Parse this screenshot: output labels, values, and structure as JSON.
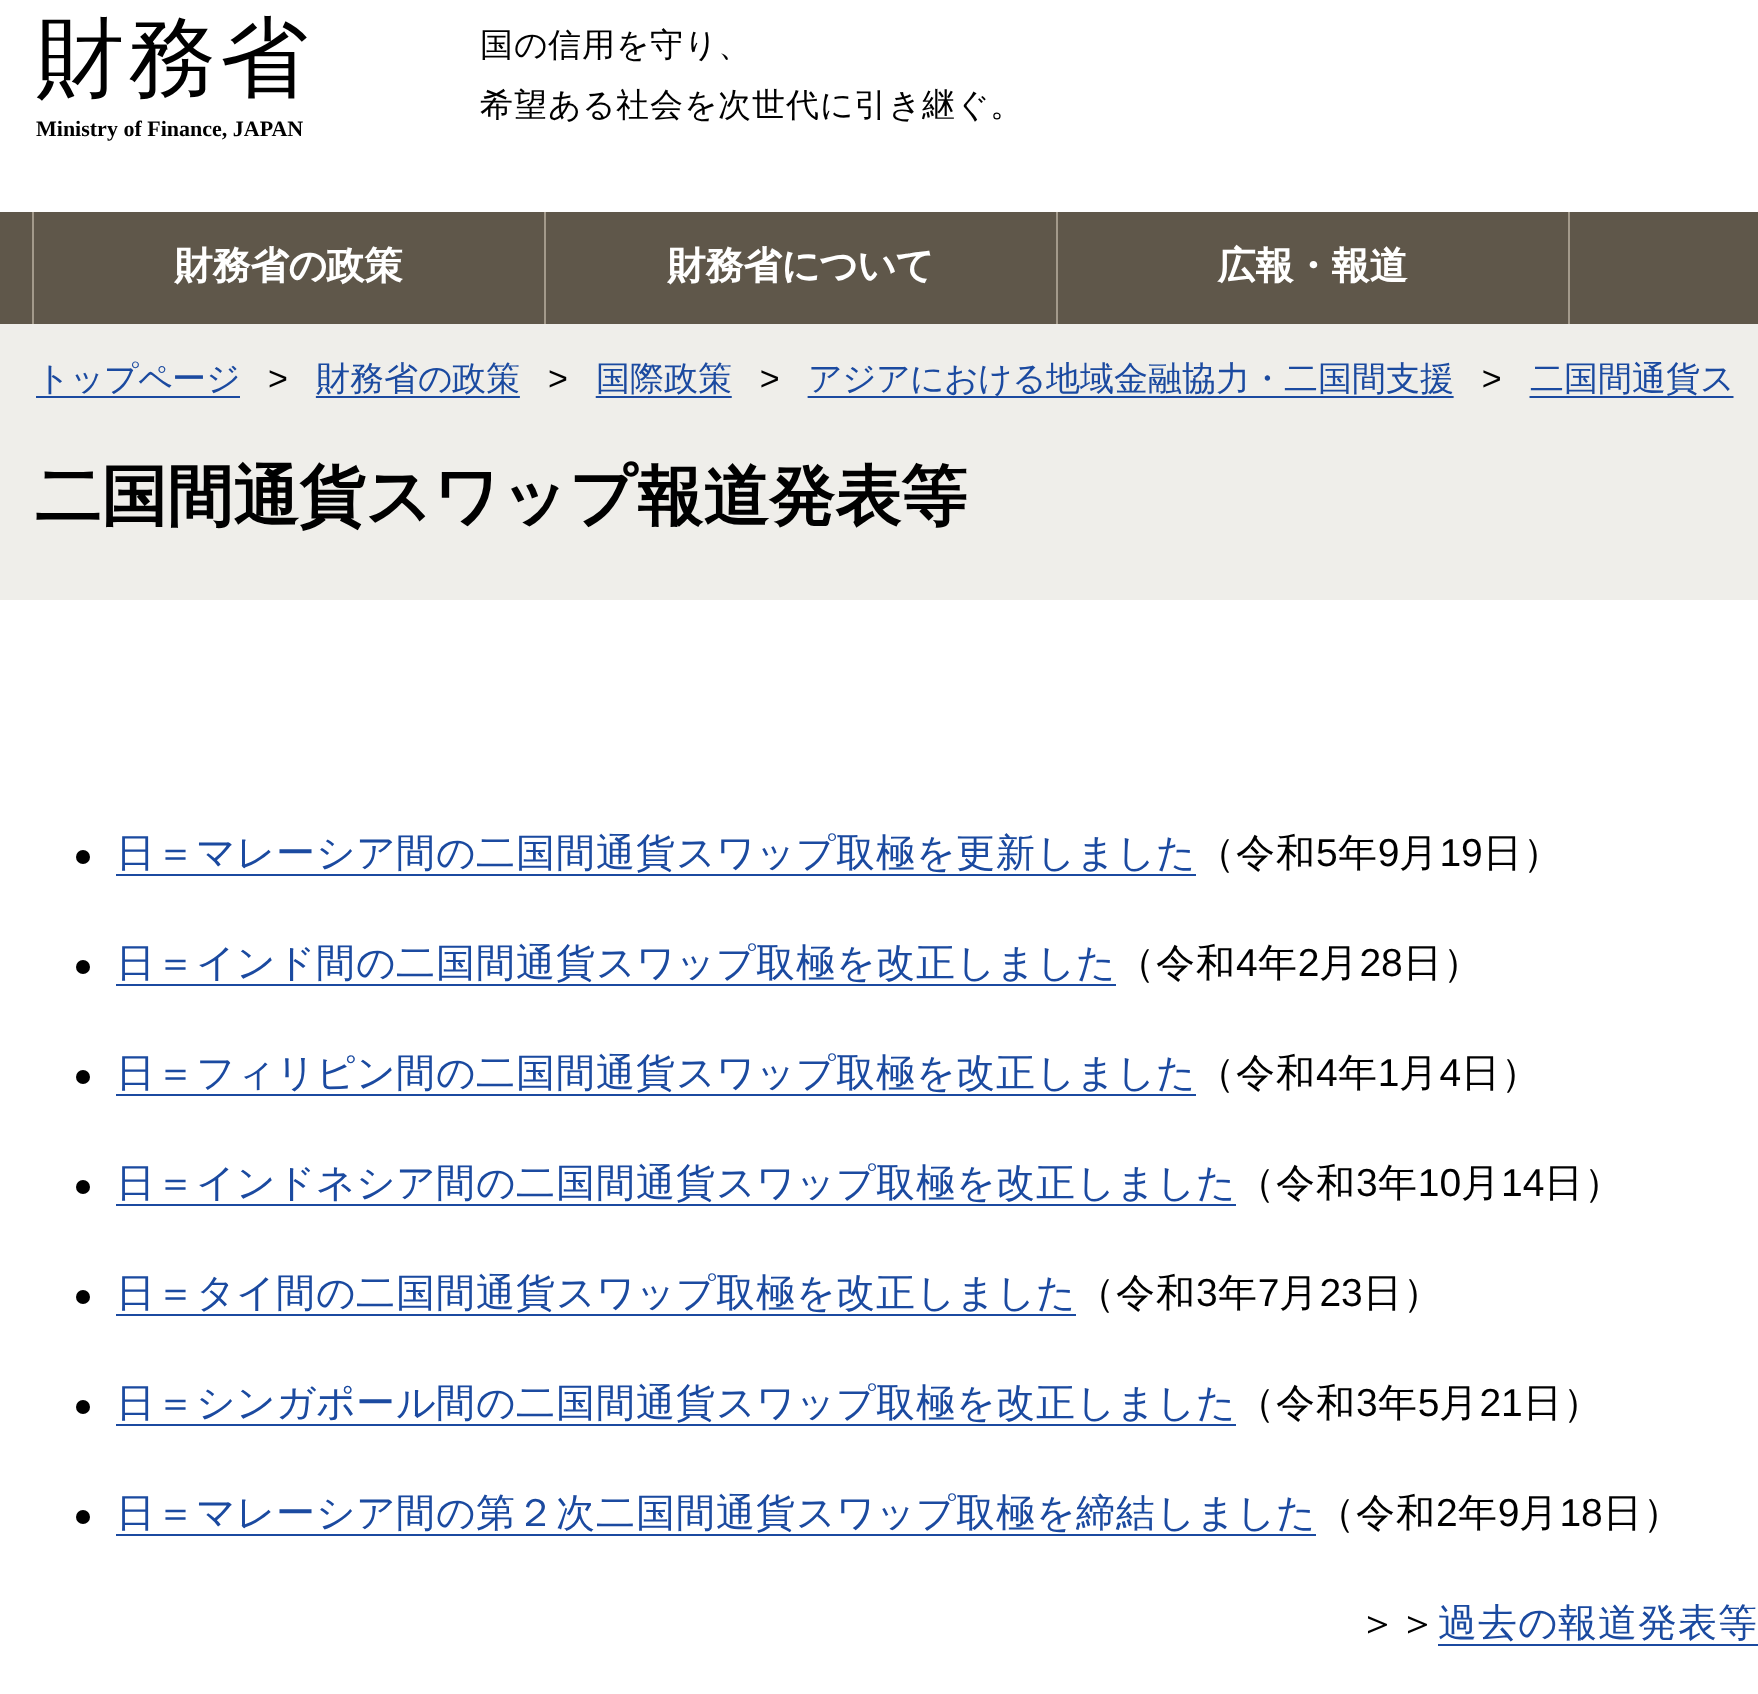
{
  "header": {
    "logo": "財務省",
    "logo_subtitle": "Ministry of Finance, JAPAN",
    "tagline": [
      "国の信用を守り、",
      "希望ある社会を次世代に引き継ぐ。"
    ]
  },
  "nav": {
    "items": [
      {
        "label": "財務省の政策"
      },
      {
        "label": "財務省について"
      },
      {
        "label": "広報・報道"
      }
    ]
  },
  "breadcrumb": {
    "items": [
      {
        "label": "トップページ"
      },
      {
        "separator": ">",
        "label": "財務省の政策"
      },
      {
        "separator": ">",
        "label": "国際政策"
      },
      {
        "separator": ">",
        "label": "アジアにおける地域金融協力・二国間支援"
      },
      {
        "separator": ">",
        "label": "二国間通貨ス"
      }
    ]
  },
  "page_title": "二国間通貨スワップ報道発表等",
  "press_releases": [
    {
      "title": "日＝マレーシア間の二国間通貨スワップ取極を更新しました",
      "date": "（令和5年9月19日）"
    },
    {
      "title": "日＝インド間の二国間通貨スワップ取極を改正しました",
      "date": "（令和4年2月28日）"
    },
    {
      "title": "日＝フィリピン間の二国間通貨スワップ取極を改正しました",
      "date": "（令和4年1月4日）"
    },
    {
      "title": "日＝インドネシア間の二国間通貨スワップ取極を改正しました",
      "date": "（令和3年10月14日）"
    },
    {
      "title": "日＝タイ間の二国間通貨スワップ取極を改正しました",
      "date": "（令和3年7月23日）"
    },
    {
      "title": "日＝シンガポール間の二国間通貨スワップ取極を改正しました",
      "date": "（令和3年5月21日）"
    },
    {
      "title": "日＝マレーシア間の第２次二国間通貨スワップ取極を締結しました",
      "date": "（令和2年9月18日）"
    }
  ],
  "more_link": {
    "prefix": "＞＞",
    "label": "過去の報道発表等"
  }
}
